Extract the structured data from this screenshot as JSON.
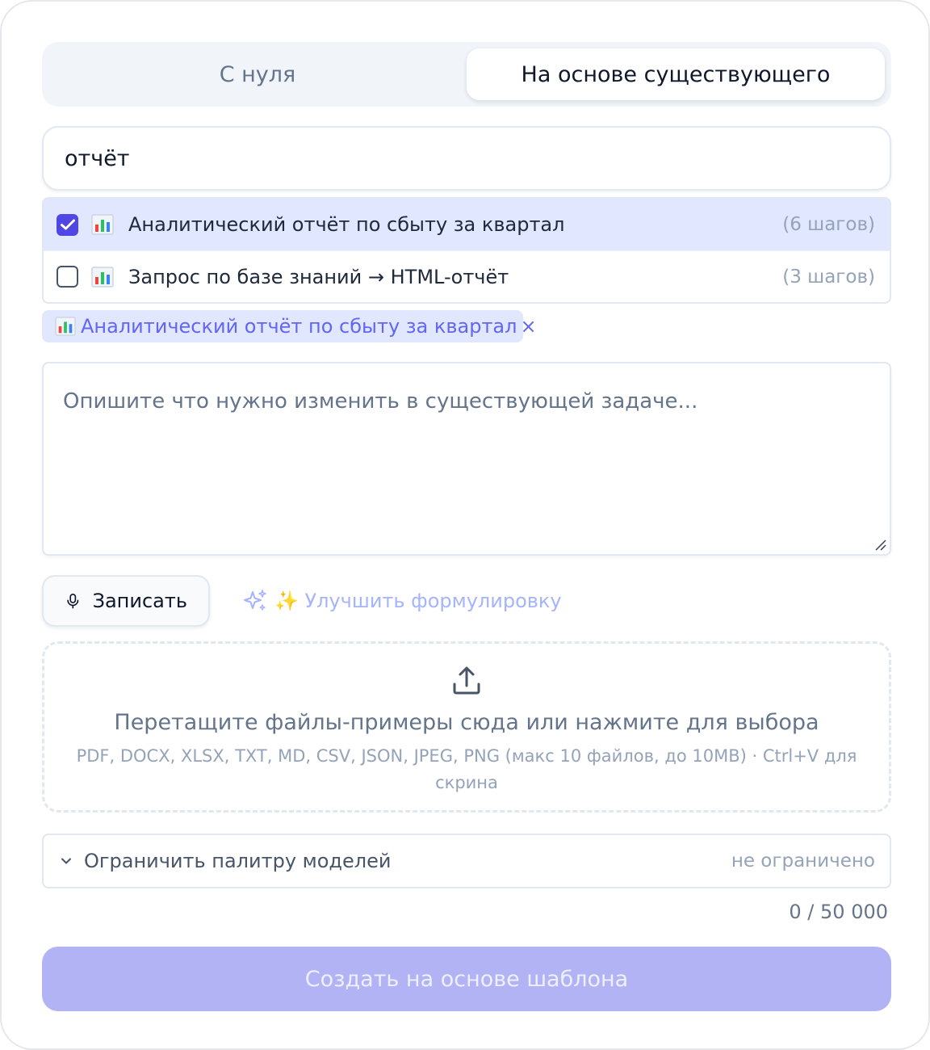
{
  "tabs": [
    {
      "label": "С нуля",
      "active": false
    },
    {
      "label": "На основе существующего",
      "active": true
    }
  ],
  "search": {
    "value": "отчёт"
  },
  "results": [
    {
      "label": "Аналитический отчёт по сбыту за квартал",
      "steps": "(6 шагов)",
      "checked": true,
      "icon": "bar-chart-icon"
    },
    {
      "label": "Запрос по базе знаний → HTML-отчёт",
      "steps": "(3 шагов)",
      "checked": false,
      "icon": "bar-chart-icon"
    }
  ],
  "selected_chip": {
    "label": "Аналитический отчёт по сбыту за квартал",
    "icon": "bar-chart-icon",
    "close": "×"
  },
  "description": {
    "placeholder": "Опишите что нужно изменить в существующей задаче...",
    "value": ""
  },
  "record_button": {
    "label": "Записать",
    "icon": "microphone-icon"
  },
  "improve_button": {
    "label": "✨ Улучшить формулировку",
    "icon": "sparkles-icon"
  },
  "dropzone": {
    "icon": "upload-icon",
    "title": "Перетащите файлы-примеры сюда или нажмите для выбора",
    "hint": "PDF, DOCX, XLSX, TXT, MD, CSV, JSON, JPEG, PNG (макс 10 файлов, до 10MB) · Ctrl+V для скрина"
  },
  "model_palette": {
    "label": "Ограничить палитру моделей",
    "status": "не ограничено",
    "icon": "chevron-down-icon"
  },
  "char_counter": "0 / 50 000",
  "submit_button": {
    "label": "Создать на основе шаблона"
  },
  "colors": {
    "accent": "#4f46e5",
    "chip_bg": "#e0e7ff",
    "submit_bg": "#b1b3f5",
    "muted_text": "#94a3b8"
  }
}
